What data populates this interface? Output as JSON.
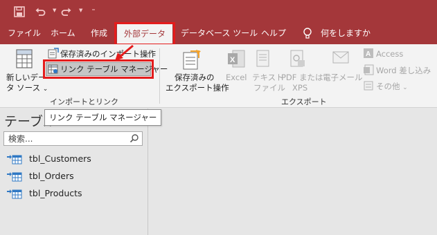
{
  "quick_access": {
    "save_icon": "save-icon",
    "undo_icon": "undo-icon",
    "redo_icon": "redo-icon",
    "customize_glyph": "⁼"
  },
  "tabs": [
    {
      "label": "ファイル"
    },
    {
      "label": "ホーム"
    },
    {
      "label": "作成"
    },
    {
      "label": "外部データ",
      "active": true
    },
    {
      "label": "データベース ツール"
    },
    {
      "label": "ヘルプ"
    },
    {
      "label": "何をしますか"
    }
  ],
  "ribbon": {
    "import_group": {
      "new_source_line1": "新しいデー",
      "new_source_line2": "タ ソース",
      "saved_imports": "保存済みのインポート操作",
      "linked_table_manager": "リンク テーブル マネージャー",
      "group_name": "インポートとリンク"
    },
    "export_group": {
      "saved_exports_line1": "保存済みの",
      "saved_exports_line2": "エクスポート操作",
      "excel": "Excel",
      "text_file_line1": "テキスト",
      "text_file_line2": "ファイル",
      "pdf_line1": "PDF または",
      "pdf_line2": "XPS",
      "email": "電子メール",
      "access": "Access",
      "word_merge": "Word 差し込み",
      "more": "その他",
      "group_name": "エクスポート"
    }
  },
  "tooltip": {
    "text": "リンク テーブル マネージャー"
  },
  "nav": {
    "title": "テーブル",
    "search_placeholder": "検索...",
    "items": [
      {
        "label": "tbl_Customers"
      },
      {
        "label": "tbl_Orders"
      },
      {
        "label": "tbl_Products"
      }
    ]
  },
  "colors": {
    "accent": "#a4373a",
    "highlight": "#e41c1c"
  }
}
